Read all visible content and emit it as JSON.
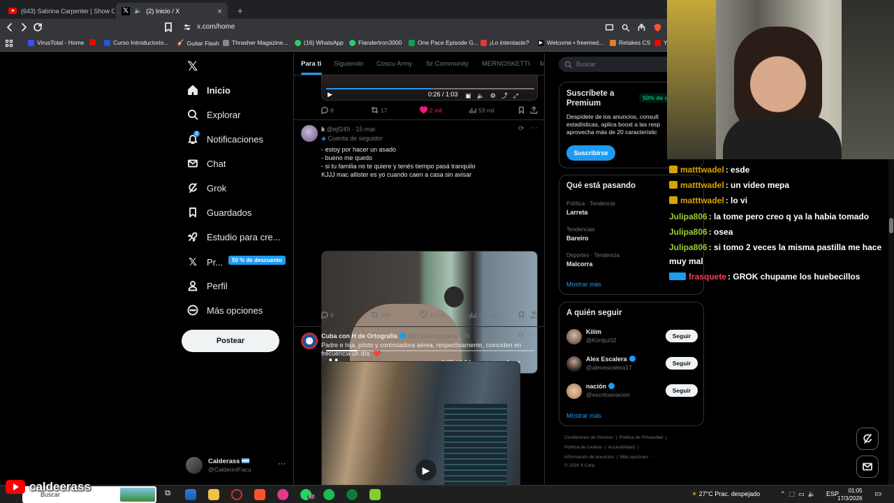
{
  "browser": {
    "tabs": [
      {
        "label": "(643) Sabrina Carpenter | Show Comp",
        "icon": "youtube-icon"
      },
      {
        "label": "(2) Inicio / X",
        "icon": "x-icon"
      }
    ],
    "url": "x.com/home",
    "bookmarks": [
      "VirusTotal - Home",
      "Curso Introductorio...",
      "Guitar Flash",
      "Thrasher Magazine...",
      "(16) WhatsApp",
      "Flandertron3000",
      "One Pace Episode G...",
      "¡Lo intentaste?",
      "Welcome • freemed...",
      "Retakes CS",
      "Y"
    ]
  },
  "sidebar": {
    "items": [
      {
        "label": "Inicio",
        "icon": "home-icon"
      },
      {
        "label": "Explorar",
        "icon": "search-icon"
      },
      {
        "label": "Notificaciones",
        "icon": "bell-icon",
        "badge": "2"
      },
      {
        "label": "Chat",
        "icon": "mail-icon"
      },
      {
        "label": "Grok",
        "icon": "grok-icon"
      },
      {
        "label": "Guardados",
        "icon": "bookmark-icon"
      },
      {
        "label": "Estudio para cre...",
        "icon": "rocket-icon"
      },
      {
        "label": "Pr...",
        "icon": "x-premium-icon"
      },
      {
        "label": "Perfil",
        "icon": "person-icon"
      },
      {
        "label": "Más opciones",
        "icon": "more-circle-icon"
      }
    ],
    "promo_badge": "50 % de descuento",
    "post_button": "Postear",
    "account": {
      "name": "Calderass",
      "handle": "@CalderinIFacu"
    }
  },
  "feed": {
    "tabs": [
      "Para ti",
      "Siguiendo",
      "Coscu Army",
      "9z Community",
      "MERNOSKETTI",
      "M"
    ],
    "tweet0": {
      "video_time": "0:26 / 1:03",
      "replies": "8",
      "retweets": "17",
      "likes": "2 mil",
      "views": "59 mil"
    },
    "tweet1": {
      "name": "k",
      "handle": "@ejf249",
      "time": "· 15 mar.",
      "follower_note": "Cuenta de seguidor",
      "text": "- estoy por hacer un asado\n- bueno me quedo\n- si tu familia no te quiere y tenés tiempo pasá tranquilo\nKJJJ mac allister es yo cuando caen a casa sin avisar",
      "video_time": "0:05 / 0:34",
      "video_progress": 0.15,
      "replies": "8",
      "retweets": "344",
      "likes": "20 mil",
      "views": "583 mil"
    },
    "tweet2": {
      "name": "Cuba con H de Ortografía",
      "handle": "@CubaOrtografia",
      "time": "· 7h",
      "text": "Padre e hija, piloto y controladora aérea, respectivamente, coinciden en\nfrecuencia un día. ❤️"
    }
  },
  "right": {
    "search_placeholder": "Buscar",
    "premium": {
      "title": "Suscríbete a Premium",
      "badge": "50% de d",
      "desc": "Despídete de los anuncios, consult\nestadísticas, aplica boost a las resp\naprovecha más de 20 característic",
      "button": "Suscribirse"
    },
    "trends": {
      "title": "Qué está pasando",
      "items": [
        {
          "context": "Política · Tendencia",
          "name": "Larreta"
        },
        {
          "context": "Tendencias",
          "name": "Bareiro"
        },
        {
          "context": "Deportes · Tendencia",
          "name": "Malcorra"
        }
      ],
      "more": "Mostrar más"
    },
    "follow": {
      "title": "A quién seguir",
      "items": [
        {
          "name": "Kiiim",
          "handle": "@Kimlpz02",
          "verified": false
        },
        {
          "name": "Alex Escalera",
          "handle": "@alexescalera17",
          "verified": true
        },
        {
          "name": "nación",
          "handle": "@escritosnacion",
          "verified": true
        }
      ],
      "button": "Seguir",
      "more": "Mostrar más"
    },
    "footer": [
      "Condiciones de Servicio",
      "Política de Privacidad",
      "Política de cookies",
      "Accesibilidad",
      "Información de anuncios",
      "Más opciones ···",
      "© 2026 X Corp."
    ]
  },
  "chat": [
    {
      "user": "matttwadel",
      "msg": ": esde",
      "color": "#d9a400"
    },
    {
      "user": "matttwadel",
      "msg": ": un video mepa",
      "color": "#d9a400"
    },
    {
      "user": "matttwadel",
      "msg": ": lo vi",
      "color": "#d9a400"
    },
    {
      "user": "Julipa806",
      "msg": ": la tome pero creo q ya la habia tomado",
      "color": "#9acd32"
    },
    {
      "user": "Julipa806",
      "msg": ": osea",
      "color": "#9acd32"
    },
    {
      "user": "Julipa806",
      "msg": ": si tomo 2 veces la misma pastilla me hace",
      "color": "#9acd32"
    },
    {
      "user": "",
      "msg": "muy mal",
      "color": "#ffffff"
    },
    {
      "user": "frasquete",
      "msg": ": GROK chupame los huebecillos",
      "color": "#ff3b5c"
    }
  ],
  "overlay": {
    "channel": "caldeerass"
  },
  "taskbar": {
    "search": "Buscar",
    "weather": "27°C  Prac. despejado",
    "lang": "ESP",
    "time": "01:05",
    "date": "17/3/2026",
    "whatsapp_badge": "87"
  },
  "colors": {
    "accent": "#1d9bf0",
    "background": "#000000",
    "like": "#f91880"
  }
}
